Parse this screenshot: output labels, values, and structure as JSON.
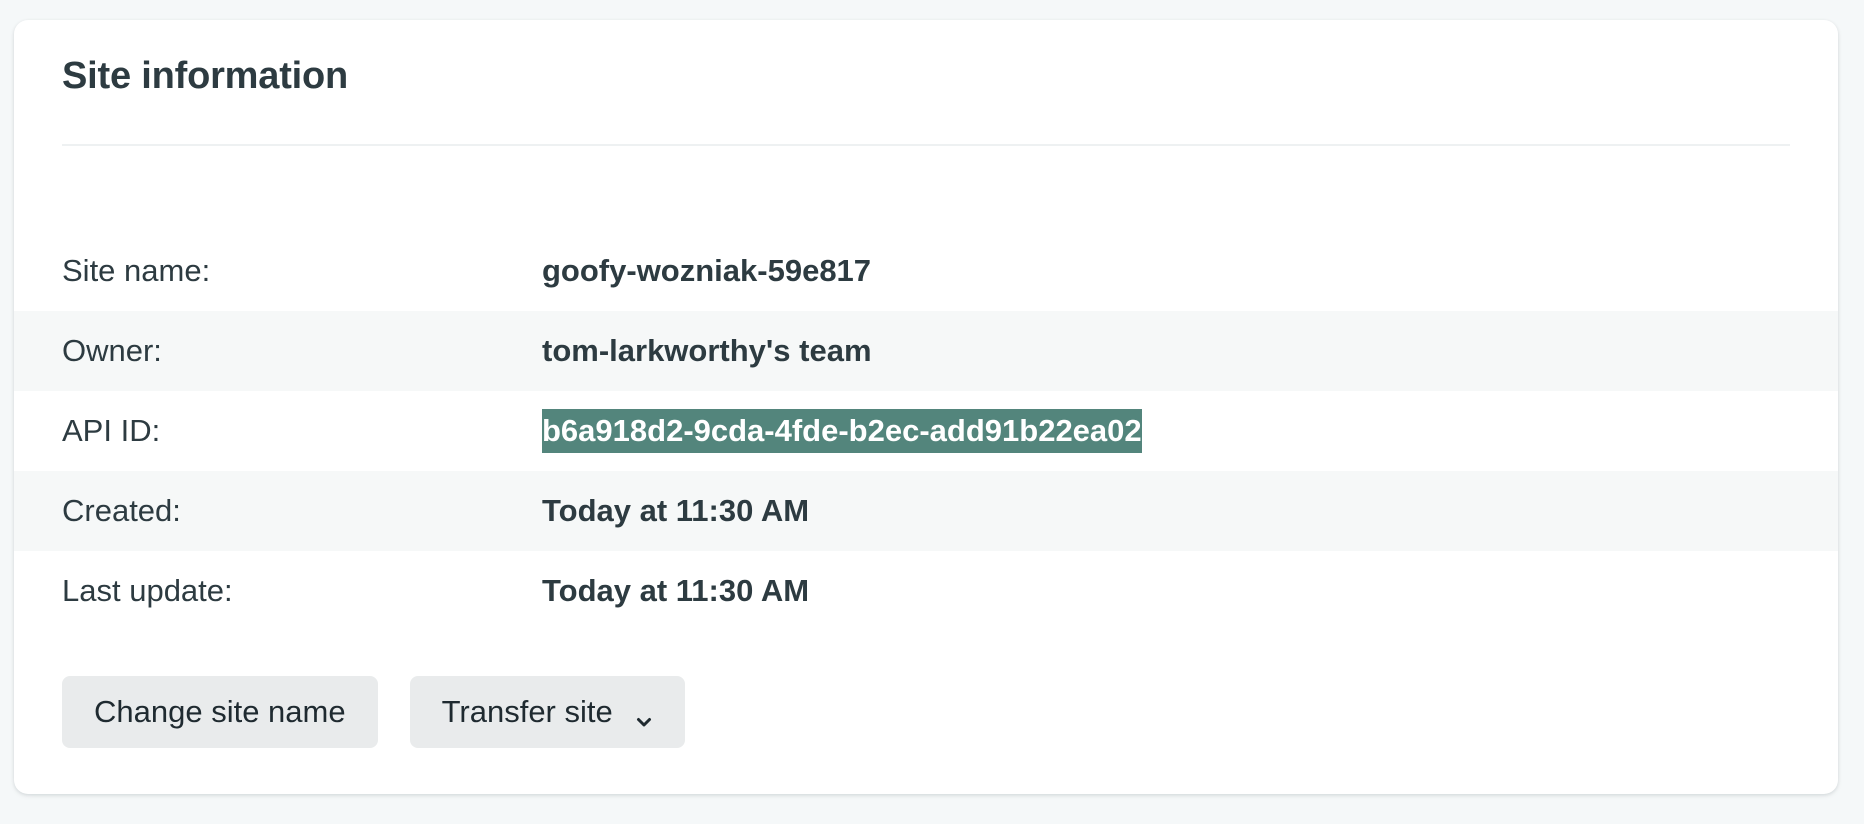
{
  "card": {
    "title": "Site information"
  },
  "info": {
    "rows": [
      {
        "label": "Site name:",
        "value": "goofy-wozniak-59e817"
      },
      {
        "label": "Owner:",
        "value": "tom-larkworthy's team"
      },
      {
        "label": "API ID:",
        "value": "b6a918d2-9cda-4fde-b2ec-add91b22ea02"
      },
      {
        "label": "Created:",
        "value": "Today at 11:30 AM"
      },
      {
        "label": "Last update:",
        "value": "Today at 11:30 AM"
      }
    ]
  },
  "actions": {
    "change_site_name": "Change site name",
    "transfer_site": "Transfer site",
    "transfer_icon": "chevron-down-icon"
  },
  "colors": {
    "selection_highlight": "#53857c",
    "alt_row_bg": "#f6f8f8",
    "button_bg": "#e9ebec",
    "page_bg": "#f5f8f9"
  }
}
